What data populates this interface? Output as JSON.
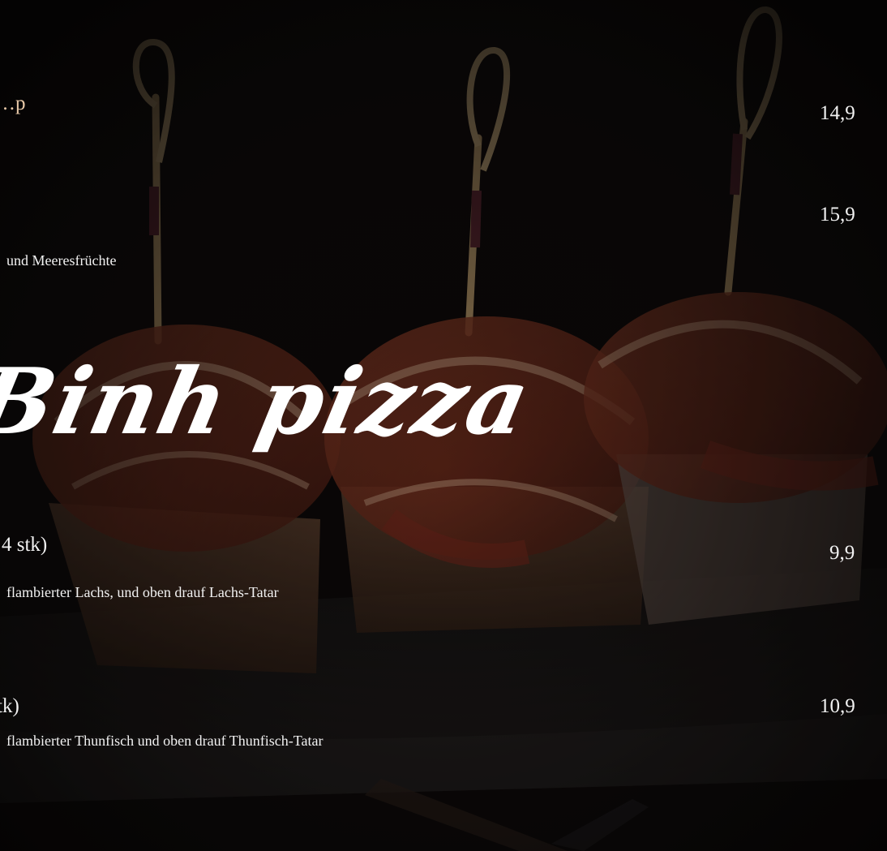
{
  "menu": {
    "section_title": "Binh pizza",
    "items": [
      {
        "name": "…p",
        "price": "14,9",
        "description": ""
      },
      {
        "name": "",
        "price": "15,9",
        "description": "und Meeresfrüchte"
      },
      {
        "name": "4 stk)",
        "price": "9,9",
        "description": "flambierter Lachs, und oben drauf Lachs-Tatar"
      },
      {
        "name": "tk)",
        "price": "10,9",
        "description": "flambierter Thunfisch und oben drauf Thunfisch-Tatar"
      }
    ]
  },
  "colors": {
    "background": "#0a0808",
    "text": "#f2f2f2",
    "accent": "#e8c9a8"
  },
  "image": {
    "subject": "three flambéed sushi pizza pieces on bamboo skewers"
  }
}
